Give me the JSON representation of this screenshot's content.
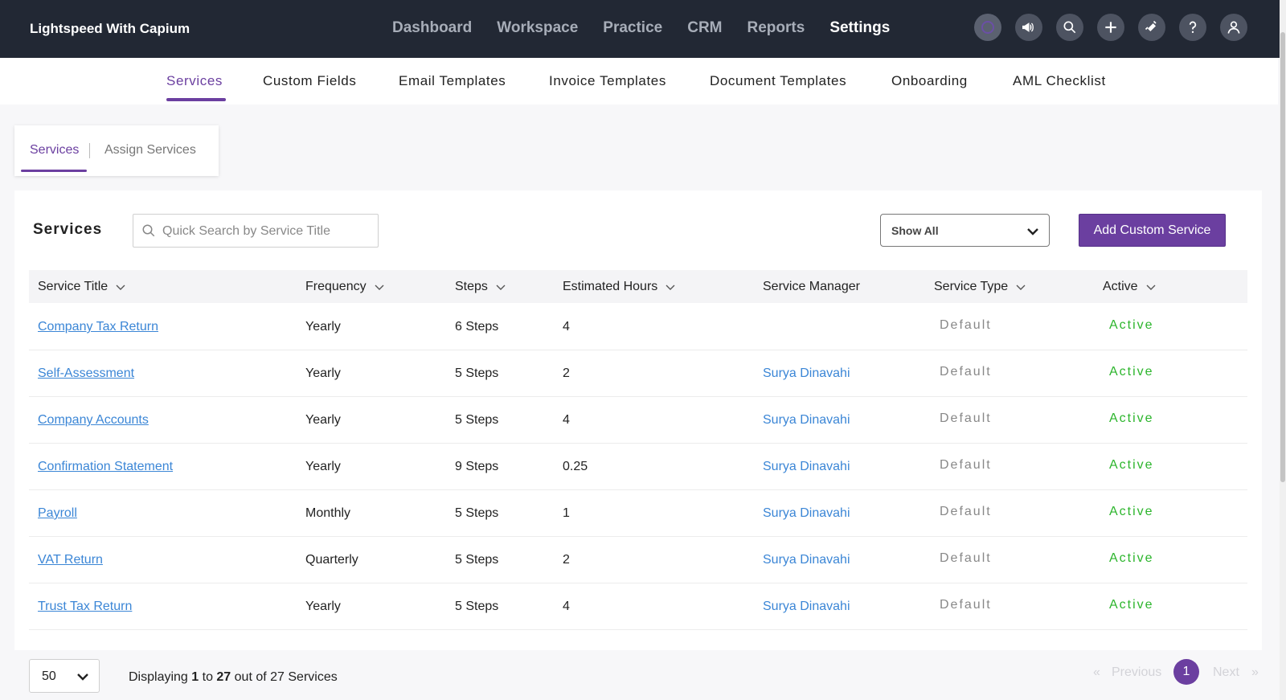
{
  "app": {
    "brand": "Lightspeed With Capium"
  },
  "main_nav": [
    {
      "label": "Dashboard",
      "active": false
    },
    {
      "label": "Workspace",
      "active": false
    },
    {
      "label": "Practice",
      "active": false
    },
    {
      "label": "CRM",
      "active": false
    },
    {
      "label": "Reports",
      "active": false
    },
    {
      "label": "Settings",
      "active": true
    }
  ],
  "top_icons": [
    "org-logo-icon",
    "megaphone-icon",
    "search-icon",
    "plus-icon",
    "ticket-icon",
    "help-icon",
    "user-icon"
  ],
  "settings_tabs": [
    {
      "label": "Services",
      "active": true
    },
    {
      "label": "Custom Fields",
      "active": false
    },
    {
      "label": "Email Templates",
      "active": false
    },
    {
      "label": "Invoice Templates",
      "active": false
    },
    {
      "label": "Document Templates",
      "active": false
    },
    {
      "label": "Onboarding",
      "active": false
    },
    {
      "label": "AML Checklist",
      "active": false
    }
  ],
  "inner_tabs": [
    {
      "label": "Services",
      "active": true
    },
    {
      "label": "Assign Services",
      "active": false
    }
  ],
  "services_card": {
    "title": "Services",
    "search_placeholder": "Quick Search by Service Title",
    "filter_value": "Show All",
    "add_button": "Add Custom Service"
  },
  "table": {
    "columns": [
      "Service Title",
      "Frequency",
      "Steps",
      "Estimated Hours",
      "Service Manager",
      "Service Type",
      "Active"
    ],
    "rows": [
      {
        "title": "Company Tax Return",
        "frequency": "Yearly",
        "steps": "6 Steps",
        "hours": "4",
        "manager": "",
        "type": "Default",
        "status": "Active"
      },
      {
        "title": "Self-Assessment",
        "frequency": "Yearly",
        "steps": "5 Steps",
        "hours": "2",
        "manager": "Surya Dinavahi",
        "type": "Default",
        "status": "Active"
      },
      {
        "title": "Company Accounts",
        "frequency": "Yearly",
        "steps": "5 Steps",
        "hours": "4",
        "manager": "Surya Dinavahi",
        "type": "Default",
        "status": "Active"
      },
      {
        "title": "Confirmation Statement",
        "frequency": "Yearly",
        "steps": "9 Steps",
        "hours": "0.25",
        "manager": "Surya Dinavahi",
        "type": "Default",
        "status": "Active"
      },
      {
        "title": "Payroll",
        "frequency": "Monthly",
        "steps": "5 Steps",
        "hours": "1",
        "manager": "Surya Dinavahi",
        "type": "Default",
        "status": "Active"
      },
      {
        "title": "VAT Return",
        "frequency": "Quarterly",
        "steps": "5 Steps",
        "hours": "2",
        "manager": "Surya Dinavahi",
        "type": "Default",
        "status": "Active"
      },
      {
        "title": "Trust Tax Return",
        "frequency": "Yearly",
        "steps": "5 Steps",
        "hours": "4",
        "manager": "Surya Dinavahi",
        "type": "Default",
        "status": "Active"
      }
    ]
  },
  "footer": {
    "page_size": "50",
    "displaying": {
      "prefix": "Displaying ",
      "from": "1",
      "to_word": " to ",
      "to": "27",
      "suffix": " out of 27 Services"
    },
    "pagination": {
      "first": "«",
      "previous": "Previous",
      "current_page": "1",
      "next": "Next",
      "last": "»"
    }
  },
  "colors": {
    "topbar": "#222834",
    "accent": "#6b3fa0",
    "link": "#3b86d6",
    "active_status": "#2cb52c"
  }
}
